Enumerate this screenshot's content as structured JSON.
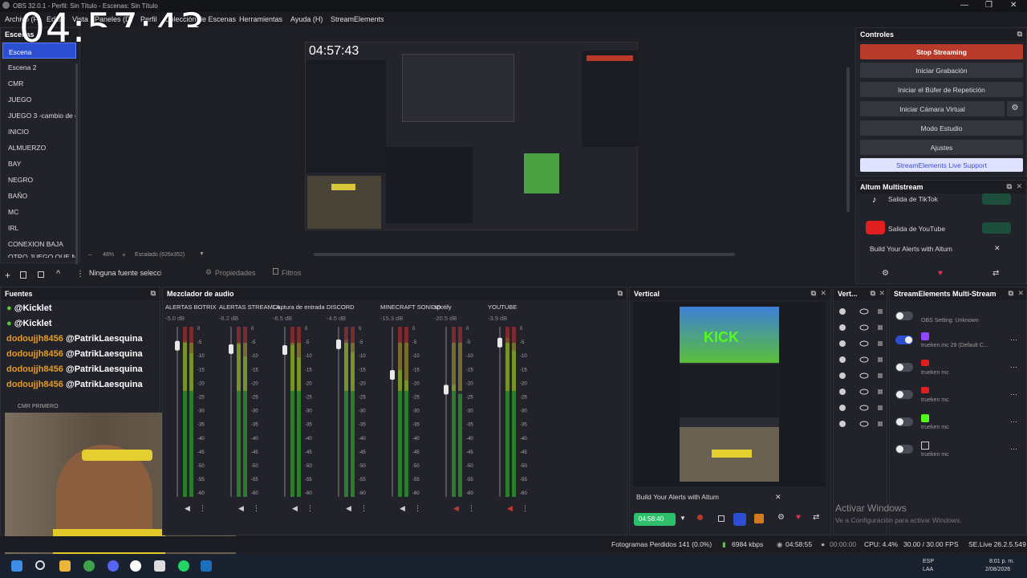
{
  "titlebar": {
    "title": "OBS 32.0.1 - Perfil: Sin Título - Escenas: Sin Título",
    "minimize": "—",
    "maximize": "❐",
    "close": "✕"
  },
  "menu": {
    "items": [
      "Archivo (F)",
      "Editar",
      "Vista",
      "Paneles (D)",
      "Perfil",
      "Colección de Escenas",
      "Herramientas",
      "Ayuda (H)",
      "StreamElements"
    ]
  },
  "clock_overlay": "04:57:43",
  "scenes": {
    "title": "Escenas",
    "items": [
      "Escena",
      "Escena 2",
      "CMR",
      "JUEGO",
      "JUEGO 3 -cambio de c",
      "INICIO",
      "ALMUERZO",
      "BAY",
      "NEGRO",
      "BAÑO",
      "MC",
      "IRL",
      "CONEXION BAJA",
      "OTRO JUEGO QUE NO"
    ]
  },
  "preview": {
    "clock": "04:57:43",
    "zoom": "48%",
    "scale": "Escalado (626x352)"
  },
  "source_toolbar": {
    "no_source": "Ninguna fuente seleccionada",
    "properties": "Propiedades",
    "filters": "Filtros"
  },
  "sources": {
    "title": "Fuentes",
    "chat": [
      {
        "user": "",
        "msg": "@Kicklet"
      },
      {
        "user": "",
        "msg": "@Kicklet"
      },
      {
        "user": "dodoujjh8456",
        "msg": "@PatrikLaesquina"
      },
      {
        "user": "dodoujjh8456",
        "msg": "@PatrikLaesquina"
      },
      {
        "user": "dodoujjh8456",
        "msg": "@PatrikLaesquina"
      },
      {
        "user": "dodoujjh8456",
        "msg": "@PatrikLaesquina"
      }
    ],
    "extra_label": "CMR PRIMERO"
  },
  "audio_mixer": {
    "title": "Mezclador de audio",
    "channels": [
      {
        "name": "ALERTAS BOTRIX",
        "db": "-5.0 dB"
      },
      {
        "name": "ALERTAS STREAMLA",
        "db": "-6.2 dB"
      },
      {
        "name": "Captura de entrada",
        "db": "-6.5 dB"
      },
      {
        "name": "DISCORD",
        "db": "-4.5 dB"
      },
      {
        "name": "MINECRAFT SONIDO",
        "db": "-15.3 dB"
      },
      {
        "name": "spotify",
        "db": "-20.5 dB"
      },
      {
        "name": "YOUTUBE",
        "db": "-3.9 dB"
      }
    ],
    "scale": [
      "0",
      "-5",
      "-10",
      "-15",
      "-20",
      "-25",
      "-30",
      "-35",
      "-40",
      "-45",
      "-50",
      "-55",
      "-60"
    ]
  },
  "vertical": {
    "title": "Vertical",
    "kick_text": "KICK",
    "altum_banner": "Build Your Alerts with Altum",
    "timer": "04:58:40"
  },
  "vert_panel": {
    "title": "Vert..."
  },
  "controls": {
    "title": "Controles",
    "stop_streaming": "Stop Streaming",
    "start_recording": "Iniciar Grabación",
    "replay_buffer": "Iniciar el Búfer de Repetición",
    "virtual_camera": "Iniciar Cámara Virtual",
    "studio_mode": "Modo Estudio",
    "settings": "Ajustes",
    "se_support": "StreamElements Live Support"
  },
  "altum": {
    "title": "Altum Multistream",
    "tiktok": "Salida de TikTok",
    "youtube": "Salida de YouTube",
    "build_alerts": "Build Your Alerts with Altum"
  },
  "se_multistream": {
    "title": "StreamElements Multi-Stream",
    "rows": [
      {
        "name": "OBS Setting: Unknown",
        "on": false
      },
      {
        "name": "trueken.mc 29 (Default C...",
        "on": true
      },
      {
        "name": "trueken mc",
        "on": false
      },
      {
        "name": "trueken mc",
        "on": false
      },
      {
        "name": "trueken mc",
        "on": false
      },
      {
        "name": "trueken mc",
        "on": false
      }
    ],
    "watermark": "Activar Windows",
    "watermark_sub": "Ve a Configuración para activar Windows."
  },
  "statusbar": {
    "dropped": "Fotogramas Perdidos 141 (0.0%)",
    "kbps": "6984 kbps",
    "live_time": "04:58:55",
    "rec_time": "00:00:00",
    "cpu": "CPU: 4.4%",
    "fps": "30.00 / 30.00 FPS",
    "se_version": "SE.Live 26.2.5.549"
  },
  "taskbar": {
    "lang": "ESP",
    "lang2": "LAA",
    "time": "8:01 p. m.",
    "date": "2/08/2026"
  },
  "colors": {
    "accent": "#2c4fd1",
    "stop": "#b83a2b",
    "meter_green": "#2e8b2e",
    "meter_yellow": "#b5a32a",
    "meter_red": "#b02c2c",
    "kick_green": "#53fc18"
  }
}
